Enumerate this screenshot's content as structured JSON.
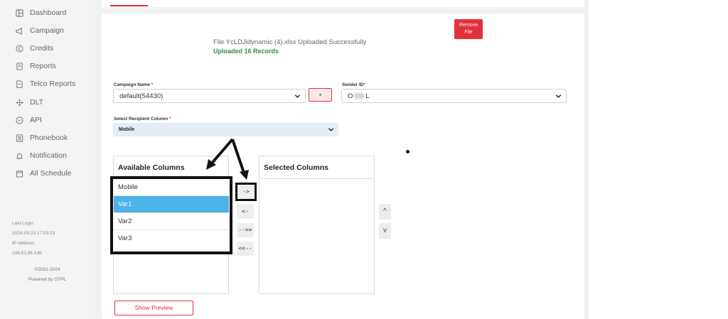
{
  "sidebar": {
    "items": [
      {
        "label": "Dashboard",
        "icon": "dashboard-icon"
      },
      {
        "label": "Campaign",
        "icon": "megaphone-icon"
      },
      {
        "label": "Credits",
        "icon": "coin-icon"
      },
      {
        "label": "Reports",
        "icon": "report-icon"
      },
      {
        "label": "Telco Reports",
        "icon": "document-icon"
      },
      {
        "label": "DLT",
        "icon": "move-icon"
      },
      {
        "label": "API",
        "icon": "api-icon"
      },
      {
        "label": "Phonebook",
        "icon": "phonebook-icon"
      },
      {
        "label": "Notification",
        "icon": "bell-icon"
      },
      {
        "label": "All Schedule",
        "icon": "calendar-icon"
      }
    ],
    "last_login_label": "Last Login",
    "last_login_value": "2024-09-23 17:53:23",
    "ip_label": "IP Address",
    "ip_value": "106.51.56.136",
    "copyright": "©2021-2024",
    "powered_by": "Powered by OTPL"
  },
  "upload": {
    "message": "File YcLDJidynamic (4).xlsx Uploaded Successfully",
    "count": "Uploaded 16 Records",
    "remove_line1": "Remove",
    "remove_line2": "File"
  },
  "form": {
    "campaign_label": "Campaign Name",
    "campaign_value": "default(54430)",
    "add_label": "+",
    "sender_label": "Sender ID",
    "sender_prefix": "O",
    "sender_suffix": "L",
    "recipient_label": "Select Recipient Column",
    "recipient_value": "Mobile",
    "required_mark": "*"
  },
  "columns": {
    "available_title": "Available Columns",
    "selected_title": "Selected Columns",
    "available": [
      "Mobile",
      "Var1",
      "Var2",
      "Var3"
    ],
    "selected_index": 1,
    "move_right": "->",
    "move_left": "<-",
    "move_all_right": "-->>",
    "move_all_left": "<<--",
    "up": "^",
    "down": "v"
  },
  "actions": {
    "preview": "Show Preview"
  },
  "colors": {
    "accent": "#e0313d",
    "success": "#2a8f44",
    "selected_row": "#4db2e7"
  }
}
